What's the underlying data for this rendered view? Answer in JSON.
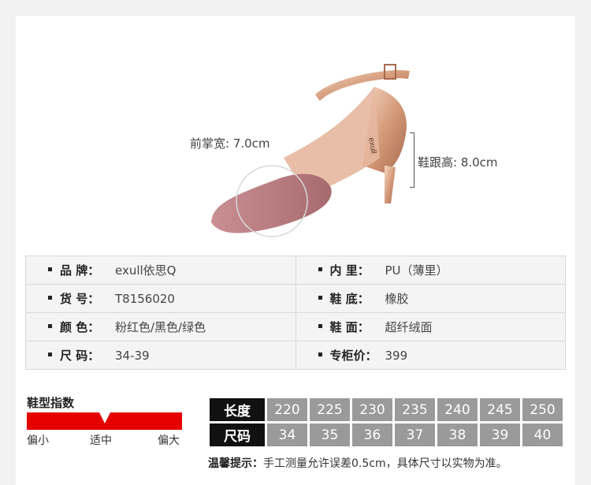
{
  "hero": {
    "width_label": "前掌宽: 7.0cm",
    "height_label": "鞋跟高: 8.0cm",
    "shoe_brand_print": "exull"
  },
  "spec": {
    "rows": [
      [
        {
          "k": "品 牌：",
          "v": "exull依思Q"
        },
        {
          "k": "内 里：",
          "v": "PU（薄里）"
        }
      ],
      [
        {
          "k": "货 号：",
          "v": "T8156020"
        },
        {
          "k": "鞋 底：",
          "v": "橡胶"
        }
      ],
      [
        {
          "k": "颜 色：",
          "v": "粉红色/黑色/绿色"
        },
        {
          "k": "鞋 面：",
          "v": "超纤绒面"
        }
      ],
      [
        {
          "k": "尺 码：",
          "v": "34-39"
        },
        {
          "k": "专柜价：",
          "v": "399"
        }
      ]
    ]
  },
  "fit": {
    "title": "鞋型指数",
    "left": "偏小",
    "mid": "适中",
    "right": "偏大",
    "level": 0.5,
    "bar_color": "#e60000"
  },
  "size_table": {
    "length_label": "长度",
    "size_label": "尺码",
    "lengths": [
      "220",
      "225",
      "230",
      "235",
      "240",
      "245",
      "250"
    ],
    "sizes": [
      "34",
      "35",
      "36",
      "37",
      "38",
      "39",
      "40"
    ]
  },
  "tip": {
    "label": "温馨提示：",
    "text": "手工测量允许误差0.5cm，具体尺寸以实物为准。"
  }
}
